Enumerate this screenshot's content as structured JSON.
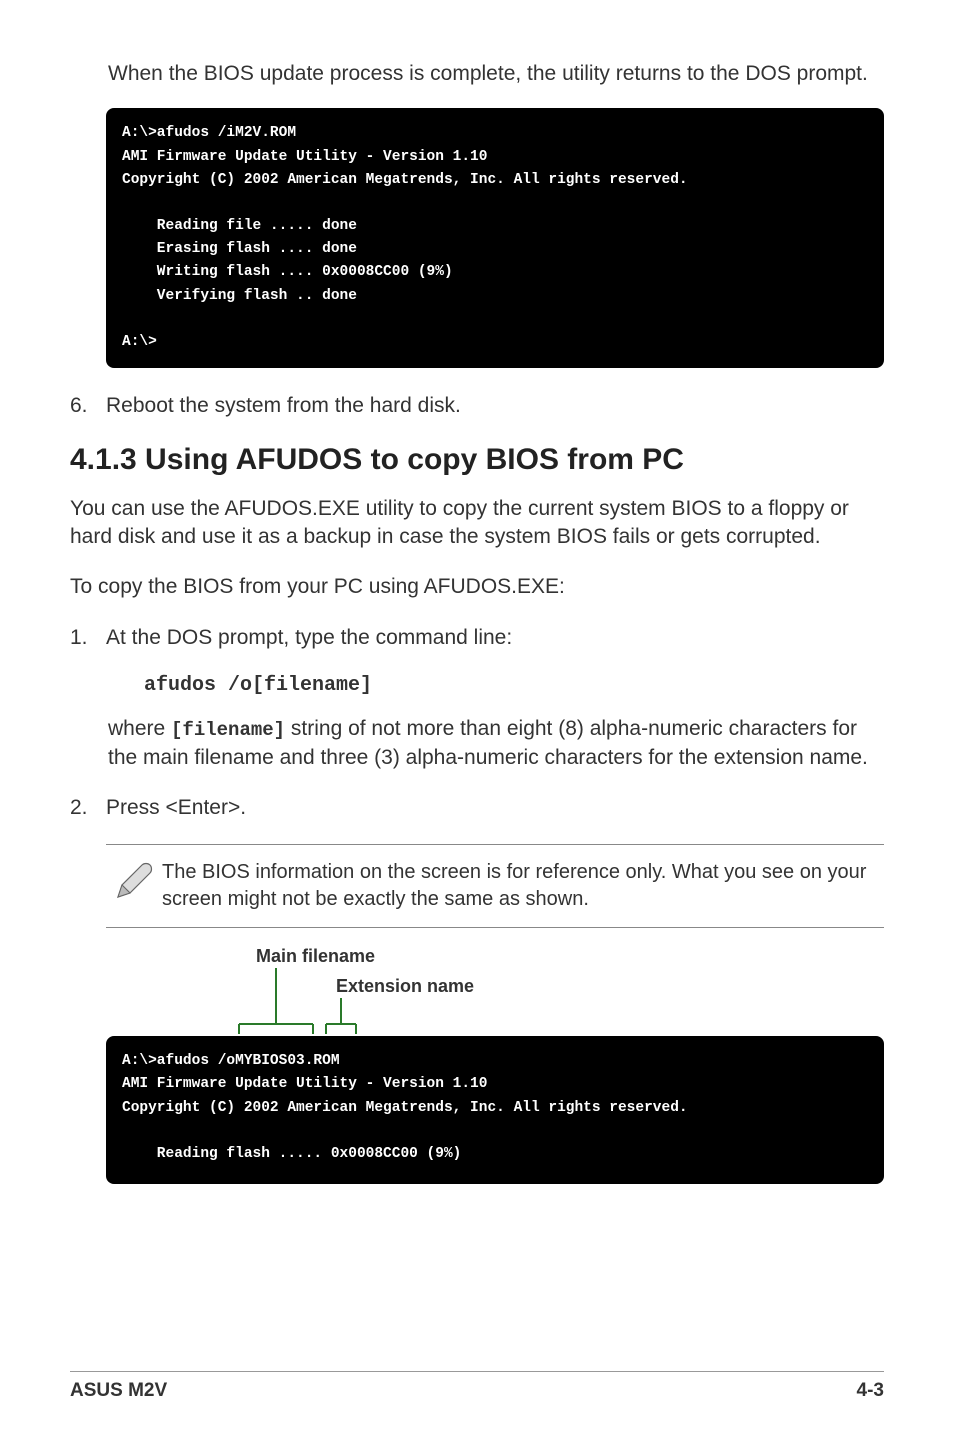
{
  "intro": "When the BIOS update process is complete, the utility returns to the DOS prompt.",
  "term1": {
    "l1": "A:\\>afudos /iM2V.ROM",
    "l2": "AMI Firmware Update Utility - Version 1.10",
    "l3": "Copyright (C) 2002 American Megatrends, Inc. All rights reserved.",
    "l4": "    Reading file ..... done",
    "l5": "    Erasing flash .... done",
    "l6": "    Writing flash .... 0x0008CC00 (9%)",
    "l7": "    Verifying flash .. done",
    "l8": "A:\\>"
  },
  "step6": {
    "num": "6.",
    "text": "Reboot the system from the hard disk."
  },
  "heading": "4.1.3   Using AFUDOS to copy BIOS from PC",
  "para1": "You can use the AFUDOS.EXE utility to copy the current system BIOS to a floppy or hard disk and use it as a backup in case the system BIOS fails or gets corrupted.",
  "para2": "To copy the BIOS from your PC using AFUDOS.EXE:",
  "step1": {
    "num": "1.",
    "text": "At the DOS prompt, type the command line:"
  },
  "cmd": "afudos /o[filename]",
  "where": {
    "pre": "where ",
    "code": "[filename]",
    "post": " string of not more than eight (8) alpha-numeric characters for the main filename and three (3) alpha-numeric characters for the extension name."
  },
  "step2": {
    "num": "2.",
    "text": "Press <Enter>."
  },
  "note": "The BIOS information on the screen is for reference only. What you see on your screen might not be exactly the same as shown.",
  "labels": {
    "main": "Main filename",
    "ext": "Extension name"
  },
  "term2": {
    "l1": "A:\\>afudos /oMYBIOS03.ROM",
    "l2": "AMI Firmware Update Utility - Version 1.10",
    "l3": "Copyright (C) 2002 American Megatrends, Inc. All rights reserved.",
    "l4": "    Reading flash ..... 0x0008CC00 (9%)"
  },
  "footer": {
    "left": "ASUS M2V",
    "right": "4-3"
  }
}
